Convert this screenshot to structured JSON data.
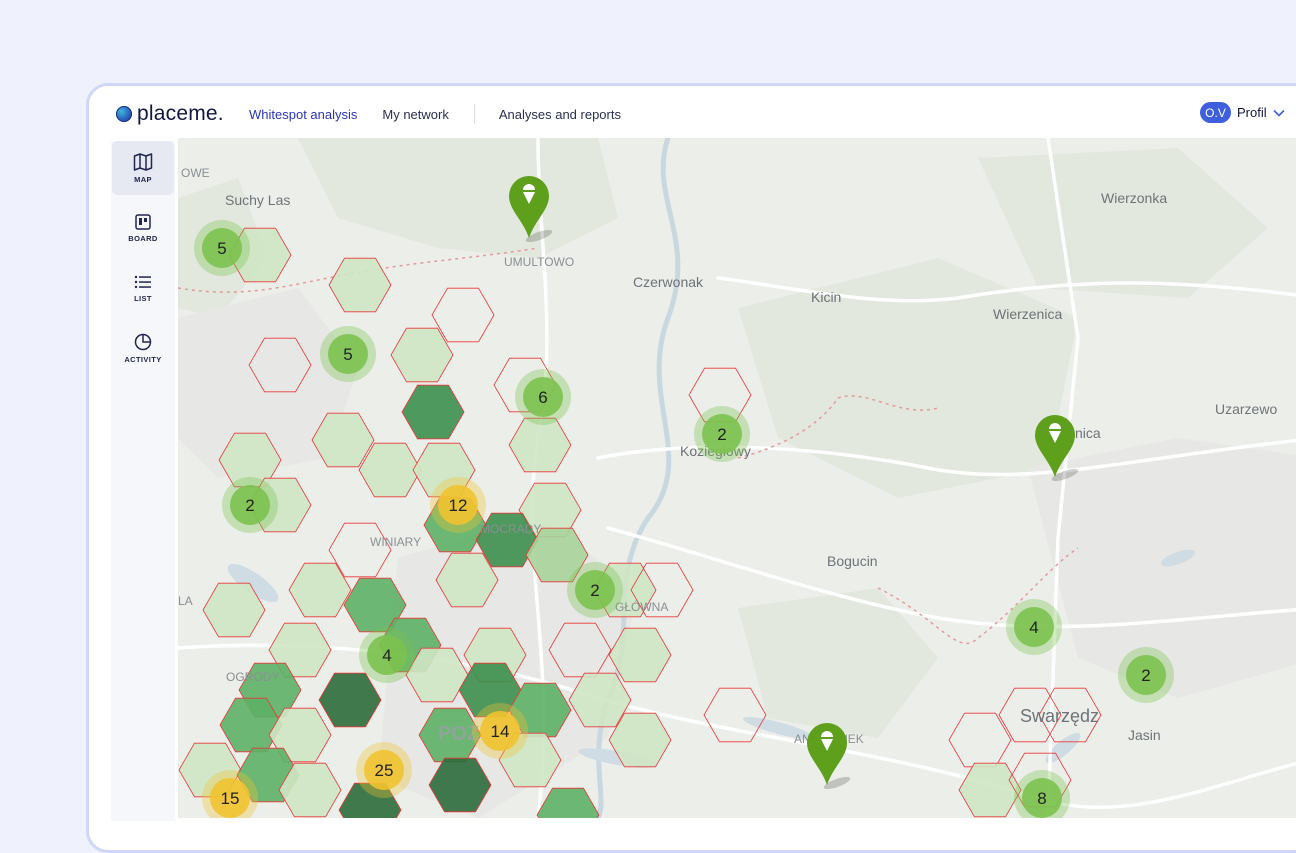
{
  "brand": {
    "name": "placeme."
  },
  "nav": {
    "items": [
      {
        "label": "Whitespot analysis",
        "active": true
      },
      {
        "label": "My network",
        "active": false
      },
      {
        "label": "Analyses and reports",
        "active": false
      }
    ]
  },
  "profile": {
    "initials": "O.V",
    "label": "Profil"
  },
  "sidebar": {
    "items": [
      {
        "label": "MAP",
        "icon": "map-icon",
        "active": true
      },
      {
        "label": "BOARD",
        "icon": "board-icon",
        "active": false
      },
      {
        "label": "LIST",
        "icon": "list-icon",
        "active": false
      },
      {
        "label": "ACTIVITY",
        "icon": "pie-chart-icon",
        "active": false
      }
    ]
  },
  "map": {
    "place_labels": [
      "OWE",
      "Suchy Las",
      "UMULTOWO",
      "Czerwonak",
      "Kicin",
      "Wierzonka",
      "Wierzenica",
      "Uzarzewo",
      "Koziegłowy",
      "nica",
      "WINIARY",
      "MOCRADY",
      "Bogucin",
      "LA",
      "GŁÓWNA",
      "OGRODY",
      "Swarzędz",
      "Jasin",
      "ANTONINEK",
      "POZ"
    ],
    "clusters": [
      {
        "count": "5",
        "color": "green"
      },
      {
        "count": "5",
        "color": "green"
      },
      {
        "count": "6",
        "color": "green"
      },
      {
        "count": "2",
        "color": "green"
      },
      {
        "count": "2",
        "color": "green"
      },
      {
        "count": "12",
        "color": "yellow"
      },
      {
        "count": "2",
        "color": "green"
      },
      {
        "count": "4",
        "color": "green"
      },
      {
        "count": "14",
        "color": "yellow"
      },
      {
        "count": "25",
        "color": "yellow"
      },
      {
        "count": "15",
        "color": "yellow"
      },
      {
        "count": "4",
        "color": "green"
      },
      {
        "count": "2",
        "color": "green"
      },
      {
        "count": "8",
        "color": "green"
      }
    ],
    "pins": [
      {
        "icon": "ice-cream-icon"
      },
      {
        "icon": "ice-cream-icon"
      },
      {
        "icon": "ice-cream-icon"
      }
    ]
  },
  "colors": {
    "accent": "#2a36b8",
    "avatar": "#3e5fde",
    "cluster_green": "#7cc24f",
    "cluster_yellow": "#f0c330",
    "pin_green": "#5e9f1c",
    "hex_border": "#e8383a"
  }
}
